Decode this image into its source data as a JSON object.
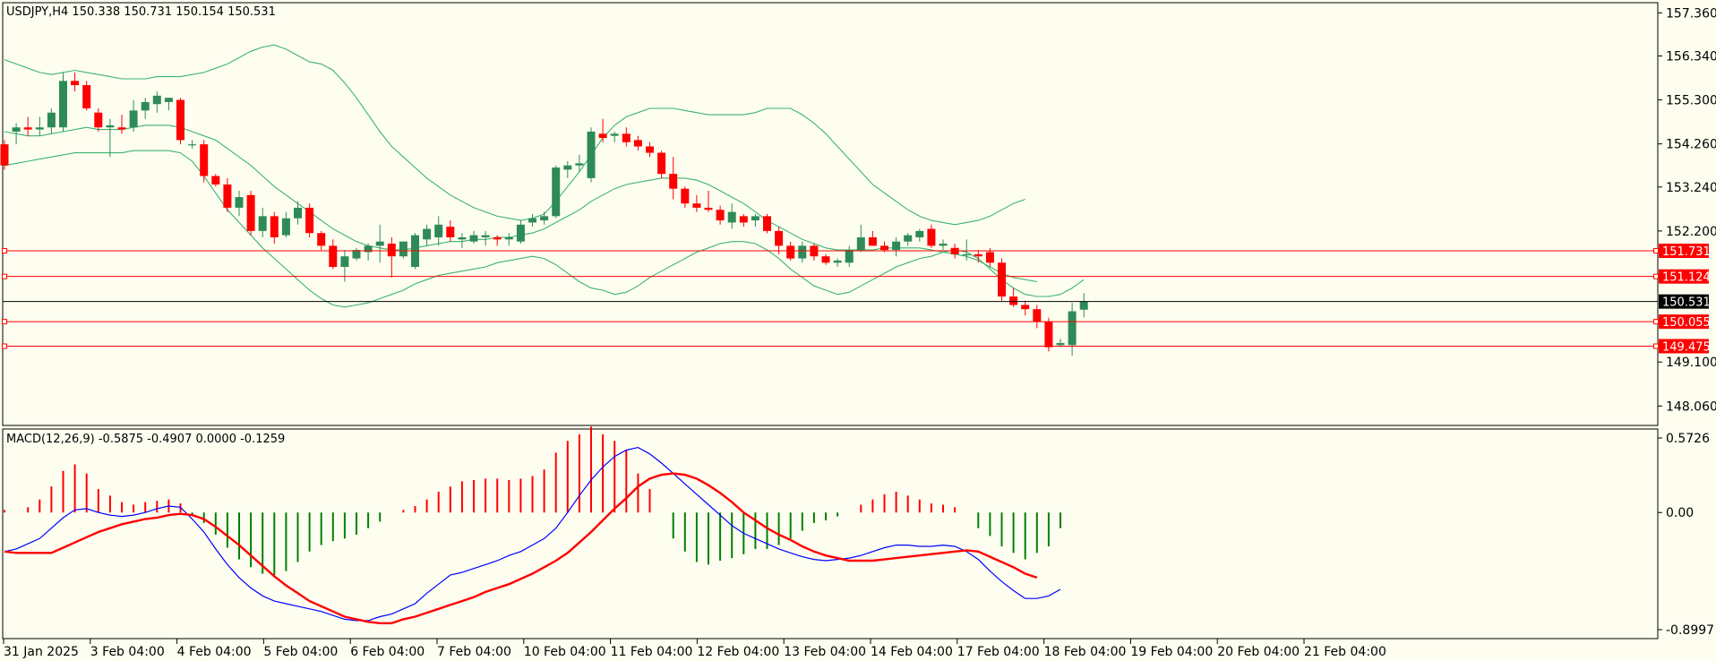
{
  "chart_data": {
    "type": "candlestick",
    "instrument_header": "USDJPY,H4  150.338 150.731 150.154 150.531",
    "price_axis": {
      "ylim": [
        147.6,
        157.6
      ],
      "ticks": [
        "157.360",
        "156.340",
        "155.300",
        "154.260",
        "153.240",
        "152.200",
        "149.100",
        "148.060"
      ]
    },
    "time_labels": [
      "31 Jan 2025",
      "3 Feb 04:00",
      "4 Feb 04:00",
      "5 Feb 04:00",
      "6 Feb 04:00",
      "7 Feb 04:00",
      "10 Feb 04:00",
      "11 Feb 04:00",
      "12 Feb 04:00",
      "13 Feb 04:00",
      "14 Feb 04:00",
      "17 Feb 04:00",
      "18 Feb 04:00",
      "19 Feb 04:00",
      "20 Feb 04:00",
      "21 Feb 04:00"
    ],
    "candles": [
      [
        154.25,
        154.35,
        153.65,
        153.75
      ],
      [
        154.55,
        154.75,
        154.25,
        154.65
      ],
      [
        154.65,
        154.9,
        154.45,
        154.6
      ],
      [
        154.6,
        154.9,
        154.45,
        154.65
      ],
      [
        154.65,
        155.1,
        154.5,
        155.0
      ],
      [
        154.65,
        155.95,
        154.55,
        155.75
      ],
      [
        155.75,
        155.95,
        155.5,
        155.65
      ],
      [
        155.65,
        155.75,
        155.05,
        155.1
      ],
      [
        155.0,
        155.1,
        154.55,
        154.65
      ],
      [
        154.65,
        154.85,
        153.95,
        154.7
      ],
      [
        154.65,
        154.95,
        154.5,
        154.6
      ],
      [
        154.65,
        155.3,
        154.55,
        155.05
      ],
      [
        155.05,
        155.35,
        154.85,
        155.25
      ],
      [
        155.2,
        155.5,
        155.0,
        155.4
      ],
      [
        155.25,
        155.35,
        155.05,
        155.35
      ],
      [
        155.3,
        155.35,
        154.25,
        154.35
      ],
      [
        154.25,
        154.35,
        154.15,
        154.25
      ],
      [
        154.25,
        154.35,
        153.35,
        153.5
      ],
      [
        153.5,
        153.55,
        153.25,
        153.3
      ],
      [
        153.3,
        153.45,
        152.65,
        152.75
      ],
      [
        152.75,
        153.15,
        152.55,
        153.0
      ],
      [
        153.05,
        153.15,
        152.1,
        152.2
      ],
      [
        152.2,
        152.75,
        152.05,
        152.55
      ],
      [
        152.55,
        152.65,
        151.9,
        152.05
      ],
      [
        152.1,
        152.65,
        152.05,
        152.5
      ],
      [
        152.5,
        152.9,
        152.35,
        152.75
      ],
      [
        152.75,
        152.85,
        152.05,
        152.15
      ],
      [
        152.15,
        152.2,
        151.75,
        151.85
      ],
      [
        151.85,
        152.0,
        151.3,
        151.35
      ],
      [
        151.35,
        151.75,
        151.0,
        151.6
      ],
      [
        151.55,
        151.8,
        151.5,
        151.75
      ],
      [
        151.7,
        151.9,
        151.5,
        151.85
      ],
      [
        151.85,
        152.35,
        151.45,
        151.95
      ],
      [
        151.9,
        152.05,
        151.1,
        151.6
      ],
      [
        151.6,
        151.95,
        151.55,
        151.95
      ],
      [
        151.35,
        152.15,
        151.3,
        152.1
      ],
      [
        152.0,
        152.35,
        151.85,
        152.25
      ],
      [
        152.05,
        152.55,
        151.85,
        152.35
      ],
      [
        152.3,
        152.45,
        151.95,
        152.05
      ],
      [
        152.0,
        152.15,
        151.8,
        152.05
      ],
      [
        151.95,
        152.2,
        151.9,
        152.1
      ],
      [
        152.05,
        152.2,
        151.85,
        152.1
      ],
      [
        152.05,
        152.1,
        151.85,
        152.0
      ],
      [
        152.0,
        152.15,
        151.85,
        152.05
      ],
      [
        151.95,
        152.45,
        151.9,
        152.35
      ],
      [
        152.4,
        152.6,
        152.3,
        152.5
      ],
      [
        152.45,
        152.65,
        152.35,
        152.55
      ],
      [
        152.55,
        153.75,
        152.5,
        153.7
      ],
      [
        153.65,
        153.85,
        153.45,
        153.75
      ],
      [
        153.75,
        154.0,
        153.6,
        153.8
      ],
      [
        153.45,
        154.65,
        153.35,
        154.55
      ],
      [
        154.5,
        154.85,
        154.3,
        154.4
      ],
      [
        154.45,
        154.55,
        154.3,
        154.5
      ],
      [
        154.5,
        154.65,
        154.2,
        154.3
      ],
      [
        154.35,
        154.45,
        154.1,
        154.2
      ],
      [
        154.2,
        154.3,
        153.95,
        154.05
      ],
      [
        154.05,
        154.1,
        153.45,
        153.55
      ],
      [
        153.55,
        153.95,
        152.95,
        153.2
      ],
      [
        153.2,
        153.25,
        152.75,
        152.85
      ],
      [
        152.85,
        153.05,
        152.65,
        152.75
      ],
      [
        152.75,
        153.15,
        152.65,
        152.7
      ],
      [
        152.7,
        152.8,
        152.35,
        152.45
      ],
      [
        152.4,
        152.85,
        152.25,
        152.65
      ],
      [
        152.55,
        152.6,
        152.3,
        152.4
      ],
      [
        152.45,
        152.6,
        152.3,
        152.55
      ],
      [
        152.55,
        152.6,
        152.15,
        152.2
      ],
      [
        152.2,
        152.3,
        151.65,
        151.85
      ],
      [
        151.85,
        151.95,
        151.5,
        151.55
      ],
      [
        151.55,
        151.95,
        151.45,
        151.85
      ],
      [
        151.85,
        151.9,
        151.5,
        151.6
      ],
      [
        151.6,
        151.65,
        151.4,
        151.45
      ],
      [
        151.45,
        151.55,
        151.35,
        151.5
      ],
      [
        151.45,
        151.85,
        151.35,
        151.75
      ],
      [
        151.75,
        152.35,
        151.7,
        152.05
      ],
      [
        152.05,
        152.2,
        151.85,
        151.85
      ],
      [
        151.85,
        151.95,
        151.7,
        151.75
      ],
      [
        151.75,
        152.05,
        151.6,
        151.95
      ],
      [
        151.95,
        152.15,
        151.85,
        152.1
      ],
      [
        152.05,
        152.25,
        151.95,
        152.2
      ],
      [
        152.25,
        152.35,
        151.8,
        151.85
      ],
      [
        151.85,
        152.0,
        151.75,
        151.9
      ],
      [
        151.8,
        151.9,
        151.55,
        151.65
      ],
      [
        151.65,
        152.0,
        151.5,
        151.65
      ],
      [
        151.65,
        151.75,
        151.45,
        151.6
      ],
      [
        151.7,
        151.8,
        151.35,
        151.45
      ],
      [
        151.45,
        151.55,
        150.55,
        150.65
      ],
      [
        150.65,
        150.85,
        150.4,
        150.45
      ],
      [
        150.45,
        150.55,
        150.2,
        150.35
      ],
      [
        150.35,
        150.45,
        149.9,
        150.05
      ],
      [
        150.05,
        150.15,
        149.35,
        149.45
      ],
      [
        149.5,
        149.65,
        149.45,
        149.55
      ],
      [
        149.5,
        150.5,
        149.25,
        150.3
      ],
      [
        150.338,
        150.731,
        150.154,
        150.531
      ]
    ],
    "bollinger_upper": [
      156.25,
      156.15,
      156.05,
      155.95,
      155.9,
      155.95,
      156.0,
      155.95,
      155.9,
      155.85,
      155.8,
      155.8,
      155.8,
      155.85,
      155.85,
      155.85,
      155.9,
      155.95,
      156.05,
      156.15,
      156.3,
      156.45,
      156.55,
      156.6,
      156.5,
      156.35,
      156.2,
      156.15,
      156.0,
      155.7,
      155.35,
      154.95,
      154.55,
      154.2,
      153.95,
      153.7,
      153.45,
      153.25,
      153.05,
      152.9,
      152.75,
      152.65,
      152.55,
      152.5,
      152.45,
      152.5,
      152.6,
      152.9,
      153.25,
      153.6,
      154.0,
      154.4,
      154.7,
      154.9,
      155.0,
      155.1,
      155.1,
      155.1,
      155.05,
      155.0,
      154.95,
      154.95,
      154.95,
      154.95,
      155.0,
      155.1,
      155.1,
      155.1,
      154.95,
      154.75,
      154.5,
      154.2,
      153.9,
      153.6,
      153.3,
      153.1,
      152.9,
      152.7,
      152.55,
      152.45,
      152.4,
      152.35,
      152.4,
      152.45,
      152.55,
      152.7,
      152.85,
      152.95
    ],
    "bollinger_middle": [
      154.55,
      154.5,
      154.45,
      154.45,
      154.5,
      154.55,
      154.6,
      154.65,
      154.6,
      154.6,
      154.6,
      154.65,
      154.7,
      154.7,
      154.7,
      154.65,
      154.55,
      154.45,
      154.35,
      154.15,
      153.95,
      153.75,
      153.5,
      153.25,
      153.05,
      152.85,
      152.65,
      152.45,
      152.25,
      152.1,
      151.95,
      151.85,
      151.8,
      151.75,
      151.75,
      151.8,
      151.85,
      151.9,
      151.95,
      151.95,
      152.0,
      152.0,
      152.05,
      152.05,
      152.1,
      152.15,
      152.25,
      152.4,
      152.55,
      152.7,
      152.9,
      153.05,
      153.2,
      153.3,
      153.35,
      153.4,
      153.45,
      153.45,
      153.45,
      153.4,
      153.3,
      153.15,
      153.0,
      152.85,
      152.65,
      152.45,
      152.3,
      152.15,
      152.0,
      151.9,
      151.8,
      151.75,
      151.75,
      151.75,
      151.75,
      151.8,
      151.8,
      151.8,
      151.8,
      151.75,
      151.7,
      151.65,
      151.6,
      151.5,
      151.35,
      151.2,
      151.1,
      151.05,
      151.0
    ],
    "bollinger_lower": [
      153.75,
      153.8,
      153.85,
      153.9,
      153.95,
      154.0,
      154.05,
      154.05,
      154.05,
      154.05,
      154.05,
      154.1,
      154.1,
      154.1,
      154.1,
      154.05,
      153.85,
      153.5,
      153.1,
      152.7,
      152.4,
      152.1,
      151.8,
      151.55,
      151.3,
      151.05,
      150.8,
      150.6,
      150.45,
      150.4,
      150.45,
      150.5,
      150.6,
      150.7,
      150.8,
      150.95,
      151.05,
      151.15,
      151.2,
      151.25,
      151.3,
      151.35,
      151.45,
      151.5,
      151.55,
      151.6,
      151.55,
      151.4,
      151.2,
      151.0,
      150.85,
      150.8,
      150.7,
      150.75,
      150.9,
      151.1,
      151.25,
      151.4,
      151.55,
      151.7,
      151.8,
      151.9,
      151.95,
      151.95,
      151.9,
      151.75,
      151.55,
      151.3,
      151.1,
      150.9,
      150.8,
      150.7,
      150.75,
      150.9,
      151.05,
      151.2,
      151.35,
      151.45,
      151.55,
      151.6,
      151.7,
      151.75,
      151.7,
      151.55,
      151.3,
      151.05,
      150.85,
      150.7,
      150.65,
      150.65,
      150.7,
      150.85,
      151.05
    ],
    "horizontal_levels": [
      {
        "label": "151.731",
        "value": 151.731,
        "color": "#ff0000"
      },
      {
        "label": "151.124",
        "value": 151.124,
        "color": "#ff0000"
      },
      {
        "label": "150.055",
        "value": 150.055,
        "color": "#ff0000"
      },
      {
        "label": "149.475",
        "value": 149.475,
        "color": "#ff0000"
      }
    ],
    "current_price": {
      "label": "150.531",
      "value": 150.531,
      "color": "#000000"
    },
    "macd": {
      "header": "MACD(12,26,9) -0.5875 -0.4907 0.0000 -0.1259",
      "ylim": [
        -0.8997,
        0.5726
      ],
      "ticks": [
        "0.5726",
        "0.00",
        "-0.8997"
      ],
      "histogram": [
        0.02,
        0.0,
        0.04,
        0.1,
        0.2,
        0.32,
        0.37,
        0.3,
        0.18,
        0.13,
        0.08,
        0.06,
        0.08,
        0.09,
        0.1,
        0.07,
        -0.02,
        -0.08,
        -0.17,
        -0.27,
        -0.36,
        -0.42,
        -0.47,
        -0.48,
        -0.45,
        -0.38,
        -0.3,
        -0.25,
        -0.22,
        -0.2,
        -0.17,
        -0.12,
        -0.07,
        0.0,
        0.02,
        0.05,
        0.1,
        0.16,
        0.2,
        0.24,
        0.25,
        0.26,
        0.26,
        0.25,
        0.26,
        0.28,
        0.33,
        0.46,
        0.55,
        0.6,
        0.66,
        0.6,
        0.55,
        0.48,
        0.3,
        0.18,
        0.0,
        -0.2,
        -0.3,
        -0.38,
        -0.4,
        -0.37,
        -0.35,
        -0.32,
        -0.28,
        -0.28,
        -0.25,
        -0.2,
        -0.14,
        -0.08,
        -0.06,
        -0.03,
        0.0,
        0.06,
        0.1,
        0.14,
        0.16,
        0.13,
        0.1,
        0.07,
        0.06,
        0.04,
        0.0,
        -0.12,
        -0.18,
        -0.26,
        -0.31,
        -0.36,
        -0.31,
        -0.26,
        -0.12
      ],
      "macd_line": [
        -0.3,
        -0.28,
        -0.24,
        -0.2,
        -0.12,
        -0.04,
        0.02,
        0.03,
        0.0,
        -0.02,
        -0.03,
        -0.02,
        0.0,
        0.03,
        0.05,
        0.04,
        -0.05,
        -0.15,
        -0.28,
        -0.4,
        -0.5,
        -0.58,
        -0.64,
        -0.68,
        -0.7,
        -0.72,
        -0.74,
        -0.76,
        -0.79,
        -0.82,
        -0.83,
        -0.83,
        -0.8,
        -0.78,
        -0.74,
        -0.7,
        -0.62,
        -0.55,
        -0.48,
        -0.46,
        -0.43,
        -0.4,
        -0.37,
        -0.33,
        -0.3,
        -0.25,
        -0.2,
        -0.12,
        0.0,
        0.13,
        0.25,
        0.35,
        0.43,
        0.48,
        0.5,
        0.45,
        0.38,
        0.3,
        0.22,
        0.14,
        0.06,
        -0.02,
        -0.1,
        -0.16,
        -0.2,
        -0.24,
        -0.28,
        -0.31,
        -0.34,
        -0.36,
        -0.37,
        -0.36,
        -0.35,
        -0.33,
        -0.3,
        -0.27,
        -0.25,
        -0.25,
        -0.26,
        -0.26,
        -0.25,
        -0.26,
        -0.3,
        -0.36,
        -0.45,
        -0.53,
        -0.6,
        -0.66,
        -0.66,
        -0.64,
        -0.59
      ],
      "signal_line": [
        -0.3,
        -0.31,
        -0.31,
        -0.31,
        -0.31,
        -0.27,
        -0.23,
        -0.19,
        -0.15,
        -0.12,
        -0.09,
        -0.07,
        -0.05,
        -0.04,
        -0.02,
        -0.01,
        -0.02,
        -0.05,
        -0.11,
        -0.18,
        -0.25,
        -0.33,
        -0.41,
        -0.49,
        -0.56,
        -0.62,
        -0.68,
        -0.72,
        -0.76,
        -0.8,
        -0.82,
        -0.84,
        -0.85,
        -0.85,
        -0.82,
        -0.8,
        -0.77,
        -0.74,
        -0.71,
        -0.68,
        -0.65,
        -0.61,
        -0.58,
        -0.55,
        -0.51,
        -0.47,
        -0.42,
        -0.37,
        -0.31,
        -0.23,
        -0.15,
        -0.06,
        0.03,
        0.11,
        0.2,
        0.26,
        0.29,
        0.3,
        0.29,
        0.26,
        0.21,
        0.15,
        0.08,
        0.0,
        -0.06,
        -0.12,
        -0.17,
        -0.21,
        -0.26,
        -0.3,
        -0.33,
        -0.35,
        -0.37,
        -0.37,
        -0.37,
        -0.36,
        -0.35,
        -0.34,
        -0.33,
        -0.32,
        -0.31,
        -0.3,
        -0.29,
        -0.3,
        -0.34,
        -0.38,
        -0.42,
        -0.47,
        -0.5
      ]
    },
    "colors": {
      "background": "#fefef0",
      "bull_candle": "#2e8b57",
      "bear_candle": "#ff0000",
      "bollinger": "#3cb371",
      "macd_line": "#0000ff",
      "signal_line": "#ff0000",
      "hist_positive": "#ff0000",
      "hist_negative": "#008000"
    }
  }
}
